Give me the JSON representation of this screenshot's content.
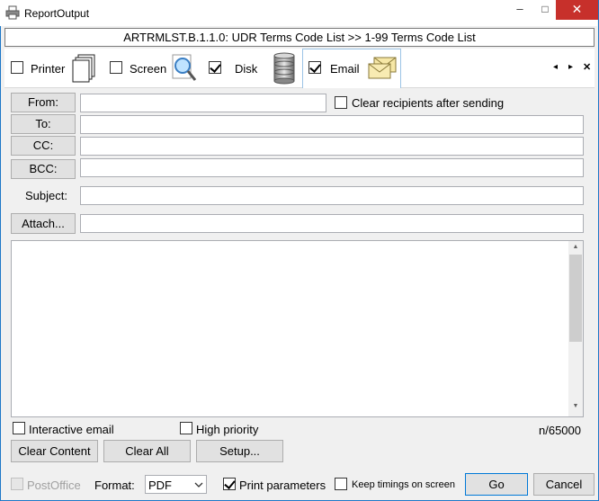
{
  "window": {
    "title": "ReportOutput",
    "minimize": "–",
    "maximize": "□",
    "close": "✕"
  },
  "header": {
    "subtitle": "ARTRMLST.B.1.1.0: UDR Terms Code List >> 1-99 Terms Code List"
  },
  "tabs": [
    {
      "label": "Printer",
      "checked": false
    },
    {
      "label": "Screen",
      "checked": false
    },
    {
      "label": "Disk",
      "checked": true
    },
    {
      "label": "Email",
      "checked": true
    }
  ],
  "tab_nav": {
    "prev": "◂",
    "next": "▸",
    "close": "✕"
  },
  "email": {
    "from_button": "From:",
    "from_value": "",
    "clear_recipients_label": "Clear recipients after sending",
    "clear_recipients_checked": false,
    "to_button": "To:",
    "to_value": "",
    "cc_button": "CC:",
    "cc_value": "",
    "bcc_button": "BCC:",
    "bcc_value": "",
    "subject_label": "Subject:",
    "subject_value": "",
    "attach_button": "Attach...",
    "attach_value": "",
    "body": "",
    "interactive_label": "Interactive email",
    "interactive_checked": false,
    "high_priority_label": "High priority",
    "high_priority_checked": false,
    "char_count": "n/65000",
    "clear_content_button": "Clear Content",
    "clear_all_button": "Clear All",
    "setup_button": "Setup..."
  },
  "footer": {
    "postoffice_label": "PostOffice",
    "format_label": "Format:",
    "format_value": "PDF",
    "print_params_label": "Print parameters",
    "print_params_checked": true,
    "keep_timings_label": "Keep timings on screen",
    "keep_timings_checked": false,
    "go_button": "Go",
    "cancel_button": "Cancel"
  }
}
